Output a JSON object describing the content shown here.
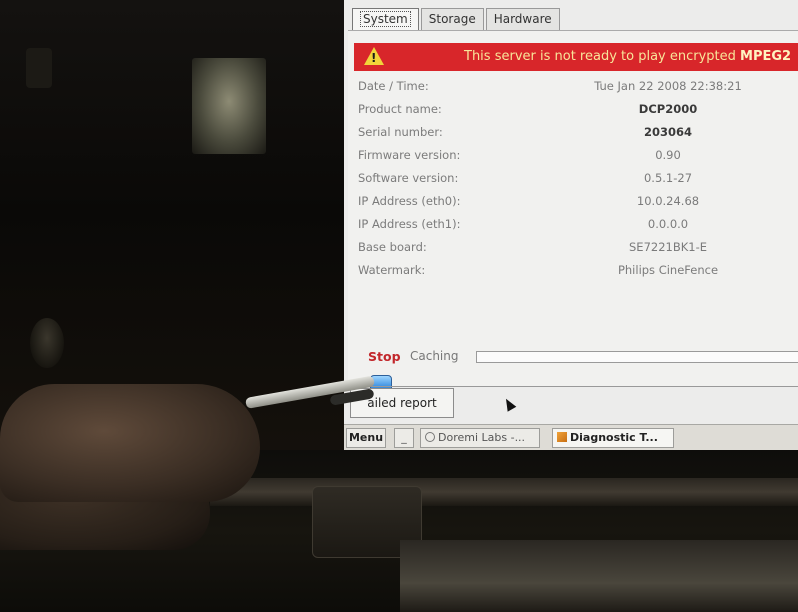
{
  "tabs": [
    {
      "label": "System",
      "active": true
    },
    {
      "label": "Storage",
      "active": false
    },
    {
      "label": "Hardware",
      "active": false
    }
  ],
  "alert": {
    "text_prefix": "This server is not ready to play encrypted",
    "text_bold": "MPEG2",
    "colors": {
      "background": "#d8262a",
      "text": "#f8e59a"
    }
  },
  "info": [
    {
      "label": "Date / Time:",
      "value": "Tue Jan 22 2008 22:38:21",
      "bold": false
    },
    {
      "label": "Product name:",
      "value": "DCP2000",
      "bold": true
    },
    {
      "label": "Serial number:",
      "value": "203064",
      "bold": true
    },
    {
      "label": "Firmware version:",
      "value": "0.90",
      "bold": false
    },
    {
      "label": "Software version:",
      "value": "0.5.1-27",
      "bold": false
    },
    {
      "label": "IP Address (eth0):",
      "value": "10.0.24.68",
      "bold": false
    },
    {
      "label": "IP Address (eth1):",
      "value": "0.0.0.0",
      "bold": false
    },
    {
      "label": "Base board:",
      "value": "SE7221BK1-E",
      "bold": false
    },
    {
      "label": "Watermark:",
      "value": "Philips CineFence",
      "bold": false
    }
  ],
  "controls": {
    "stop_label": "Stop",
    "caching_label": "Caching",
    "caching_progress": 0,
    "report_button_label": "ailed report"
  },
  "taskbar": {
    "menu_label": "Menu",
    "minimize_label": "_",
    "doremi_label": "Doremi Labs -...",
    "diagnostic_label": "Diagnostic T..."
  },
  "colors": {
    "stop": "#c2272b",
    "screen_bg": "#ececeb"
  }
}
